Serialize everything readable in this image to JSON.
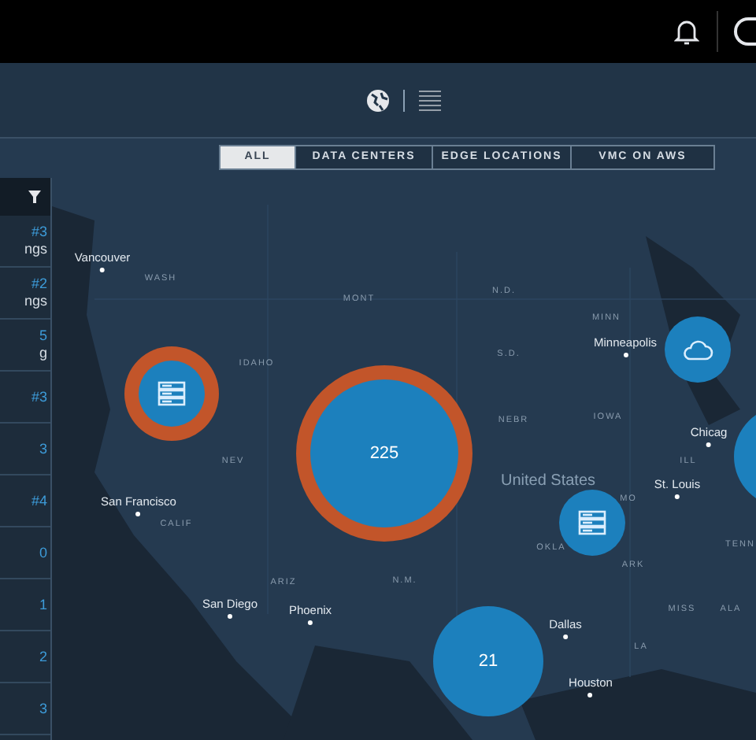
{
  "view_toggle": [
    {
      "kind": "map",
      "selected": true
    },
    {
      "kind": "list",
      "selected": false
    }
  ],
  "filters": [
    {
      "label": "ALL",
      "selected": true
    },
    {
      "label": "DATA CENTERS",
      "selected": false
    },
    {
      "label": "EDGE LOCATIONS",
      "selected": false
    },
    {
      "label": "VMC ON AWS",
      "selected": false
    }
  ],
  "sidebar": {
    "items": [
      {
        "title": "#3",
        "subtitle": "ngs"
      },
      {
        "title": "#2",
        "subtitle": "ngs"
      },
      {
        "title": "5",
        "subtitle": "g"
      },
      {
        "title": "#3"
      },
      {
        "title": "3"
      },
      {
        "title": "#4"
      },
      {
        "title": "0"
      },
      {
        "title": "1"
      },
      {
        "title": "2"
      },
      {
        "title": "3"
      }
    ]
  },
  "map": {
    "labels": [
      {
        "text": "Vancouver",
        "kind": "city"
      },
      {
        "text": "WASH",
        "kind": "state"
      },
      {
        "text": "MONT",
        "kind": "state"
      },
      {
        "text": "N.D.",
        "kind": "state"
      },
      {
        "text": "MINN",
        "kind": "state"
      },
      {
        "text": "Minneapolis",
        "kind": "city"
      },
      {
        "text": "IDAHO",
        "kind": "state"
      },
      {
        "text": "S.D.",
        "kind": "state"
      },
      {
        "text": "NEBR",
        "kind": "state"
      },
      {
        "text": "IOWA",
        "kind": "state"
      },
      {
        "text": "Chicag",
        "kind": "city"
      },
      {
        "text": "NEV",
        "kind": "state"
      },
      {
        "text": "ILL",
        "kind": "state"
      },
      {
        "text": "United States",
        "kind": "country"
      },
      {
        "text": "St. Louis",
        "kind": "city"
      },
      {
        "text": "San Francisco",
        "kind": "city"
      },
      {
        "text": "CALIF",
        "kind": "state"
      },
      {
        "text": "MO",
        "kind": "state"
      },
      {
        "text": "OKLA",
        "kind": "state"
      },
      {
        "text": "TENN",
        "kind": "state"
      },
      {
        "text": "ARK",
        "kind": "state"
      },
      {
        "text": "ARIZ",
        "kind": "state"
      },
      {
        "text": "N.M.",
        "kind": "state"
      },
      {
        "text": "San Diego",
        "kind": "city"
      },
      {
        "text": "Phoenix",
        "kind": "city"
      },
      {
        "text": "MISS",
        "kind": "state"
      },
      {
        "text": "ALA",
        "kind": "state"
      },
      {
        "text": "Dallas",
        "kind": "city"
      },
      {
        "text": "LA",
        "kind": "state"
      },
      {
        "text": "Houston",
        "kind": "city"
      }
    ],
    "clusters": [
      {
        "kind": "server",
        "ring": true
      },
      {
        "kind": "count",
        "label": "225",
        "ring": true
      },
      {
        "kind": "cloud",
        "ring": false
      },
      {
        "kind": "server",
        "ring": false
      },
      {
        "kind": "count",
        "label": "21",
        "ring": false
      },
      {
        "kind": "blank",
        "ring": false
      }
    ]
  }
}
